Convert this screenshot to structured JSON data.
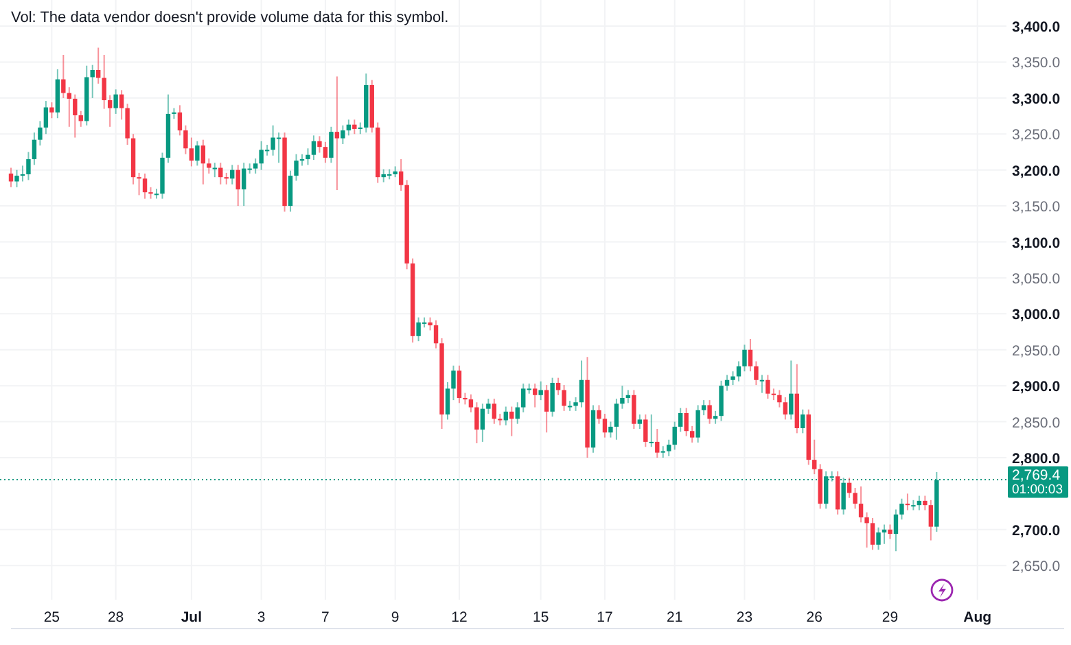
{
  "legend": {
    "vol_text": "Vol: The data vendor doesn't provide volume data for this symbol."
  },
  "chart": {
    "chart_data": {
      "type": "candlestick",
      "grid": true,
      "ref_lines": [
        {
          "axis": "y",
          "value": 2769.4,
          "color": "#089981"
        }
      ],
      "ylim": [
        2602.5,
        3436.3
      ],
      "yticks": [
        {
          "value": 3400,
          "label": "3,400.0"
        },
        {
          "value": 3350,
          "label": "3,350.0"
        },
        {
          "value": 3300,
          "label": "3,300.0"
        },
        {
          "value": 3250,
          "label": "3,250.0"
        },
        {
          "value": 3200,
          "label": "3,200.0"
        },
        {
          "value": 3150,
          "label": "3,150.0"
        },
        {
          "value": 3100,
          "label": "3,100.0"
        },
        {
          "value": 3050,
          "label": "3,050.0"
        },
        {
          "value": 3000,
          "label": "3,000.0"
        },
        {
          "value": 2950,
          "label": "2,950.0"
        },
        {
          "value": 2900,
          "label": "2,900.0"
        },
        {
          "value": 2850,
          "label": "2,850.0"
        },
        {
          "value": 2800,
          "label": "2,800.0"
        },
        {
          "value": 2700,
          "label": "2,700.0"
        },
        {
          "value": 2650,
          "label": "2,650.0"
        }
      ],
      "categories": [
        null,
        null,
        null,
        null,
        null,
        null,
        null,
        "25",
        null,
        null,
        null,
        null,
        null,
        null,
        null,
        null,
        null,
        null,
        "28",
        null,
        null,
        null,
        null,
        null,
        null,
        null,
        null,
        null,
        null,
        null,
        null,
        "Jul",
        null,
        null,
        null,
        null,
        null,
        null,
        null,
        null,
        null,
        null,
        null,
        "3",
        null,
        null,
        null,
        null,
        null,
        null,
        null,
        null,
        null,
        null,
        "7",
        null,
        null,
        null,
        null,
        null,
        null,
        null,
        null,
        null,
        null,
        null,
        "9",
        null,
        null,
        null,
        null,
        null,
        null,
        null,
        null,
        null,
        null,
        "12",
        null,
        null,
        null,
        null,
        null,
        null,
        null,
        null,
        null,
        null,
        null,
        null,
        null,
        "15",
        null,
        null,
        null,
        null,
        null,
        null,
        null,
        null,
        null,
        null,
        "17",
        null,
        null,
        null,
        null,
        null,
        null,
        null,
        null,
        null,
        null,
        null,
        "21",
        null,
        null,
        null,
        null,
        null,
        null,
        null,
        null,
        null,
        null,
        null,
        "23",
        null,
        null,
        null,
        null,
        null,
        null,
        null,
        null,
        null,
        null,
        null,
        "26",
        null,
        null,
        null,
        null,
        null,
        null,
        null,
        null,
        null,
        null,
        null,
        null,
        "29",
        null,
        null,
        null,
        null,
        null,
        null,
        null,
        null,
        null,
        null,
        null,
        null,
        null,
        null,
        "Aug"
      ],
      "ohlc": [
        [
          3195,
          3203,
          3176,
          3184
        ],
        [
          3184,
          3200,
          3176,
          3192
        ],
        [
          3192,
          3206,
          3184,
          3194
        ],
        [
          3194,
          3225,
          3186,
          3215
        ],
        [
          3215,
          3252,
          3207,
          3242
        ],
        [
          3242,
          3268,
          3234,
          3259
        ],
        [
          3259,
          3296,
          3250,
          3287
        ],
        [
          3287,
          3294,
          3272,
          3280
        ],
        [
          3280,
          3340,
          3272,
          3326
        ],
        [
          3326,
          3360,
          3300,
          3307
        ],
        [
          3307,
          3315,
          3260,
          3299
        ],
        [
          3299,
          3305,
          3245,
          3276
        ],
        [
          3276,
          3282,
          3260,
          3268
        ],
        [
          3268,
          3345,
          3262,
          3329
        ],
        [
          3329,
          3346,
          3300,
          3339
        ],
        [
          3339,
          3370,
          3320,
          3328
        ],
        [
          3328,
          3360,
          3285,
          3297
        ],
        [
          3297,
          3304,
          3260,
          3286
        ],
        [
          3286,
          3312,
          3278,
          3305
        ],
        [
          3305,
          3311,
          3270,
          3286
        ],
        [
          3286,
          3292,
          3235,
          3244
        ],
        [
          3244,
          3250,
          3180,
          3190
        ],
        [
          3190,
          3196,
          3165,
          3188
        ],
        [
          3188,
          3195,
          3160,
          3169
        ],
        [
          3169,
          3176,
          3160,
          3167
        ],
        [
          3167,
          3174,
          3160,
          3167
        ],
        [
          3167,
          3224,
          3160,
          3217
        ],
        [
          3217,
          3305,
          3210,
          3278
        ],
        [
          3278,
          3286,
          3271,
          3280
        ],
        [
          3280,
          3290,
          3248,
          3255
        ],
        [
          3255,
          3262,
          3222,
          3230
        ],
        [
          3230,
          3245,
          3205,
          3213
        ],
        [
          3213,
          3240,
          3206,
          3234
        ],
        [
          3234,
          3242,
          3180,
          3209
        ],
        [
          3209,
          3216,
          3195,
          3203
        ],
        [
          3203,
          3210,
          3190,
          3203
        ],
        [
          3203,
          3210,
          3180,
          3190
        ],
        [
          3190,
          3196,
          3180,
          3188
        ],
        [
          3188,
          3207,
          3180,
          3200
        ],
        [
          3200,
          3207,
          3150,
          3173
        ],
        [
          3173,
          3210,
          3150,
          3202
        ],
        [
          3202,
          3209,
          3195,
          3202
        ],
        [
          3202,
          3216,
          3195,
          3209
        ],
        [
          3209,
          3240,
          3200,
          3228
        ],
        [
          3228,
          3235,
          3220,
          3228
        ],
        [
          3228,
          3262,
          3220,
          3245
        ],
        [
          3245,
          3252,
          3210,
          3245
        ],
        [
          3245,
          3252,
          3142,
          3150
        ],
        [
          3150,
          3199,
          3142,
          3192
        ],
        [
          3192,
          3222,
          3185,
          3213
        ],
        [
          3213,
          3222,
          3206,
          3215
        ],
        [
          3215,
          3230,
          3207,
          3221
        ],
        [
          3221,
          3248,
          3214,
          3240
        ],
        [
          3240,
          3247,
          3224,
          3232
        ],
        [
          3232,
          3239,
          3210,
          3217
        ],
        [
          3217,
          3260,
          3210,
          3253
        ],
        [
          3253,
          3330,
          3172,
          3244
        ],
        [
          3244,
          3262,
          3236,
          3255
        ],
        [
          3255,
          3270,
          3248,
          3263
        ],
        [
          3263,
          3270,
          3250,
          3257
        ],
        [
          3257,
          3266,
          3250,
          3259
        ],
        [
          3259,
          3334,
          3252,
          3318
        ],
        [
          3318,
          3325,
          3252,
          3259
        ],
        [
          3259,
          3266,
          3182,
          3190
        ],
        [
          3190,
          3201,
          3183,
          3194
        ],
        [
          3194,
          3201,
          3187,
          3194
        ],
        [
          3194,
          3205,
          3190,
          3198
        ],
        [
          3198,
          3215,
          3171,
          3179
        ],
        [
          3179,
          3186,
          3062,
          3070
        ],
        [
          3070,
          3077,
          2960,
          2969
        ],
        [
          2969,
          2995,
          2962,
          2988
        ],
        [
          2988,
          2995,
          2981,
          2988
        ],
        [
          2988,
          2995,
          2977,
          2984
        ],
        [
          2984,
          2991,
          2952,
          2959
        ],
        [
          2959,
          2966,
          2840,
          2860
        ],
        [
          2860,
          2905,
          2853,
          2896
        ],
        [
          2896,
          2928,
          2880,
          2921
        ],
        [
          2921,
          2928,
          2876,
          2883
        ],
        [
          2883,
          2890,
          2874,
          2881
        ],
        [
          2881,
          2888,
          2863,
          2870
        ],
        [
          2870,
          2877,
          2820,
          2839
        ],
        [
          2839,
          2875,
          2822,
          2868
        ],
        [
          2868,
          2882,
          2861,
          2875
        ],
        [
          2875,
          2882,
          2847,
          2854
        ],
        [
          2854,
          2861,
          2845,
          2852
        ],
        [
          2852,
          2871,
          2845,
          2864
        ],
        [
          2864,
          2871,
          2830,
          2854
        ],
        [
          2854,
          2877,
          2847,
          2870
        ],
        [
          2870,
          2903,
          2863,
          2896
        ],
        [
          2896,
          2903,
          2889,
          2896
        ],
        [
          2896,
          2903,
          2870,
          2887
        ],
        [
          2887,
          2906,
          2880,
          2894
        ],
        [
          2894,
          2901,
          2835,
          2864
        ],
        [
          2864,
          2911,
          2857,
          2904
        ],
        [
          2904,
          2911,
          2887,
          2894
        ],
        [
          2894,
          2901,
          2865,
          2872
        ],
        [
          2872,
          2879,
          2865,
          2872
        ],
        [
          2872,
          2884,
          2865,
          2877
        ],
        [
          2877,
          2935,
          2870,
          2908
        ],
        [
          2908,
          2940,
          2800,
          2814
        ],
        [
          2814,
          2873,
          2807,
          2866
        ],
        [
          2866,
          2873,
          2847,
          2854
        ],
        [
          2854,
          2861,
          2828,
          2835
        ],
        [
          2835,
          2850,
          2828,
          2843
        ],
        [
          2843,
          2882,
          2825,
          2875
        ],
        [
          2875,
          2900,
          2868,
          2883
        ],
        [
          2883,
          2894,
          2876,
          2887
        ],
        [
          2887,
          2894,
          2840,
          2847
        ],
        [
          2847,
          2860,
          2840,
          2853
        ],
        [
          2853,
          2860,
          2815,
          2822
        ],
        [
          2822,
          2860,
          2815,
          2822
        ],
        [
          2822,
          2840,
          2800,
          2807
        ],
        [
          2807,
          2816,
          2800,
          2809
        ],
        [
          2809,
          2825,
          2802,
          2818
        ],
        [
          2818,
          2850,
          2811,
          2843
        ],
        [
          2843,
          2869,
          2836,
          2862
        ],
        [
          2862,
          2869,
          2830,
          2837
        ],
        [
          2837,
          2844,
          2821,
          2828
        ],
        [
          2828,
          2873,
          2821,
          2866
        ],
        [
          2866,
          2880,
          2859,
          2873
        ],
        [
          2873,
          2880,
          2847,
          2854
        ],
        [
          2854,
          2865,
          2847,
          2858
        ],
        [
          2858,
          2907,
          2851,
          2900
        ],
        [
          2900,
          2915,
          2893,
          2908
        ],
        [
          2908,
          2920,
          2901,
          2913
        ],
        [
          2913,
          2934,
          2906,
          2927
        ],
        [
          2927,
          2957,
          2920,
          2950
        ],
        [
          2950,
          2965,
          2920,
          2927
        ],
        [
          2927,
          2934,
          2901,
          2908
        ],
        [
          2908,
          2915,
          2890,
          2908
        ],
        [
          2908,
          2915,
          2882,
          2889
        ],
        [
          2889,
          2896,
          2880,
          2887
        ],
        [
          2887,
          2894,
          2870,
          2877
        ],
        [
          2877,
          2884,
          2853,
          2860
        ],
        [
          2860,
          2935,
          2853,
          2889
        ],
        [
          2889,
          2930,
          2834,
          2841
        ],
        [
          2841,
          2867,
          2834,
          2860
        ],
        [
          2860,
          2867,
          2790,
          2797
        ],
        [
          2797,
          2825,
          2777,
          2784
        ],
        [
          2784,
          2791,
          2729,
          2736
        ],
        [
          2736,
          2781,
          2729,
          2774
        ],
        [
          2774,
          2781,
          2767,
          2774
        ],
        [
          2774,
          2781,
          2721,
          2728
        ],
        [
          2728,
          2772,
          2721,
          2765
        ],
        [
          2765,
          2772,
          2744,
          2751
        ],
        [
          2751,
          2758,
          2729,
          2736
        ],
        [
          2736,
          2760,
          2710,
          2717
        ],
        [
          2717,
          2724,
          2675,
          2709
        ],
        [
          2709,
          2716,
          2672,
          2679
        ],
        [
          2679,
          2703,
          2672,
          2696
        ],
        [
          2696,
          2707,
          2680,
          2700
        ],
        [
          2700,
          2707,
          2687,
          2694
        ],
        [
          2694,
          2728,
          2670,
          2721
        ],
        [
          2721,
          2743,
          2714,
          2736
        ],
        [
          2736,
          2750,
          2727,
          2734
        ],
        [
          2734,
          2741,
          2727,
          2734
        ],
        [
          2734,
          2747,
          2727,
          2740
        ],
        [
          2740,
          2747,
          2727,
          2734
        ],
        [
          2734,
          2741,
          2685,
          2704
        ],
        [
          2704,
          2780,
          2697,
          2769
        ],
        null,
        null,
        null,
        null,
        null,
        null,
        null
      ]
    },
    "date_label_bold": [
      false,
      false,
      true,
      false,
      false,
      false,
      false,
      false,
      false,
      false,
      false,
      false,
      false,
      true
    ],
    "last_price": "2,769.4",
    "countdown": "01:00:03"
  }
}
